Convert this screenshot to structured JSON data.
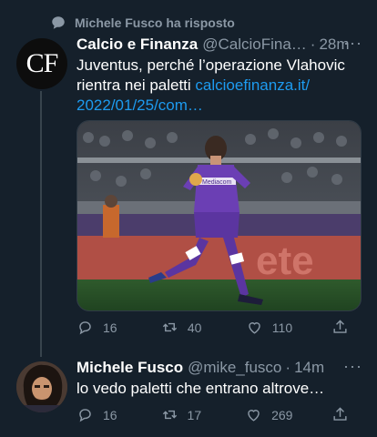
{
  "social_context": {
    "icon": "reply-bubble-icon",
    "text": "Michele Fusco ha risposto"
  },
  "tweet1": {
    "avatar_text": "CF",
    "name": "Calcio e Finanza",
    "handle": "@CalcioFina…",
    "dot": "·",
    "time": "28m",
    "more": "···",
    "text": "Juventus, perché l’operazione Vlahovic rientra nei paletti ",
    "link": "calcioefinanza.it/\n2022/01/25/com…",
    "media_desc": "photo",
    "jersey_text": "Mediacom",
    "stats": {
      "replies": "16",
      "retweets": "40",
      "likes": "110"
    }
  },
  "tweet2": {
    "name": "Michele Fusco",
    "handle": "@mike_fusco",
    "dot": "·",
    "time": "14m",
    "more": "···",
    "text": "lo vedo paletti che entrano altrove…",
    "stats": {
      "replies": "16",
      "retweets": "17",
      "likes": "269"
    }
  },
  "colors": {
    "background": "#15202b",
    "secondary": "#8b98a5",
    "link": "#1d9bf0",
    "thread": "#38444d"
  }
}
